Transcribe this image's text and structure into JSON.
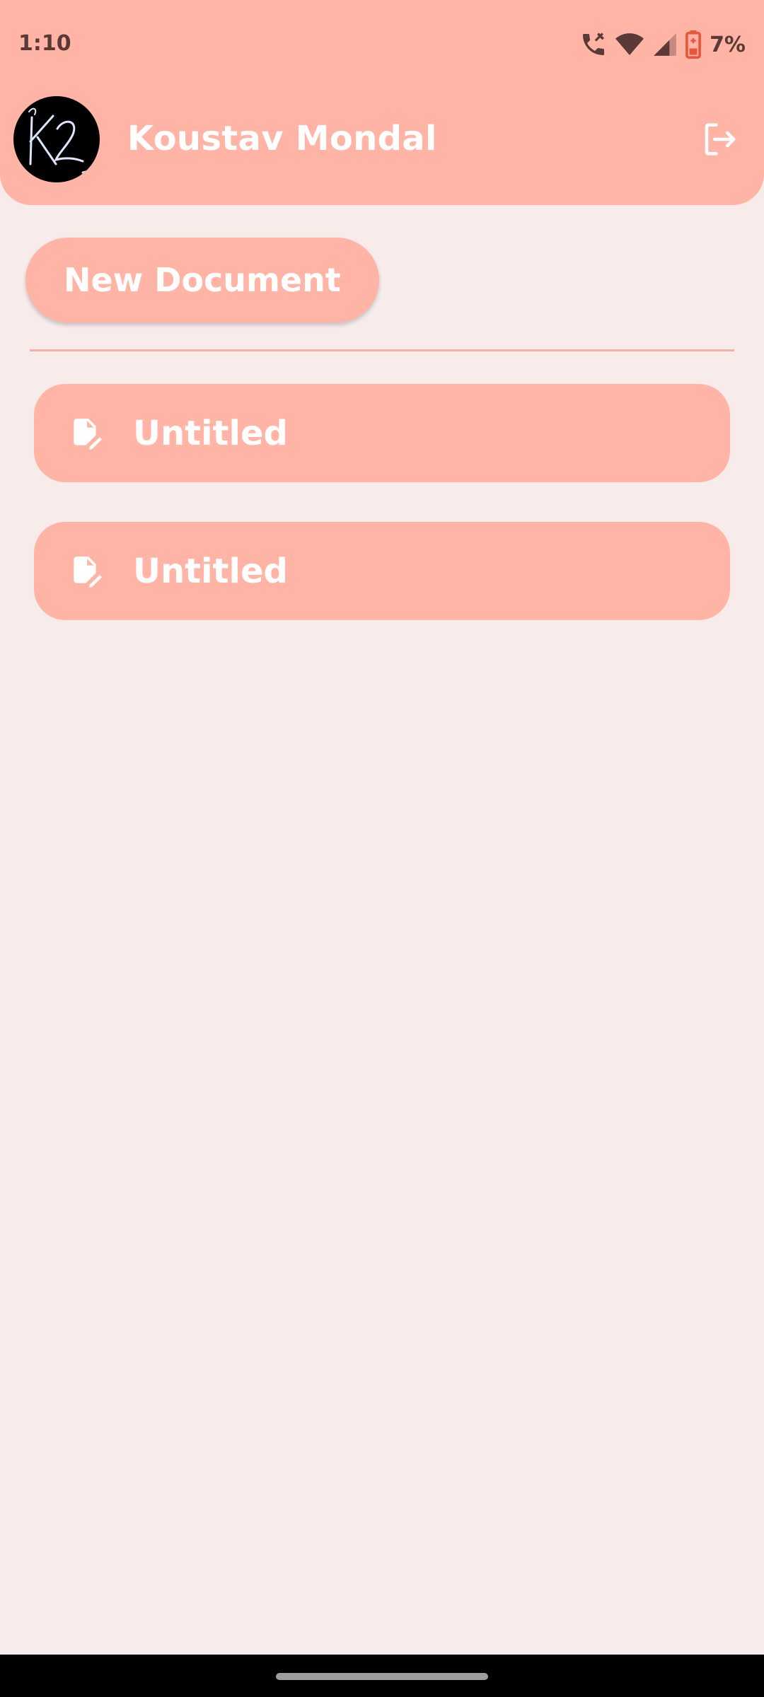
{
  "status_bar": {
    "time": "1:10",
    "battery_percent": "7%",
    "icons": [
      "wifi-call-icon",
      "wifi-icon",
      "cellular-signal-icon",
      "battery-low-icon"
    ],
    "battery_color": "#E8553A"
  },
  "header": {
    "user_name": "Koustav Mondal",
    "avatar_text": "K2",
    "logout_icon": "logout-icon",
    "background_color": "#FFB4A6"
  },
  "actions": {
    "new_document_label": "New Document"
  },
  "documents": [
    {
      "title": "Untitled",
      "icon": "edit-document-icon"
    },
    {
      "title": "Untitled",
      "icon": "edit-document-icon"
    }
  ],
  "colors": {
    "accent": "#FFB4A6",
    "background": "#F8ECEB",
    "text_on_accent": "#FFFFFF"
  }
}
